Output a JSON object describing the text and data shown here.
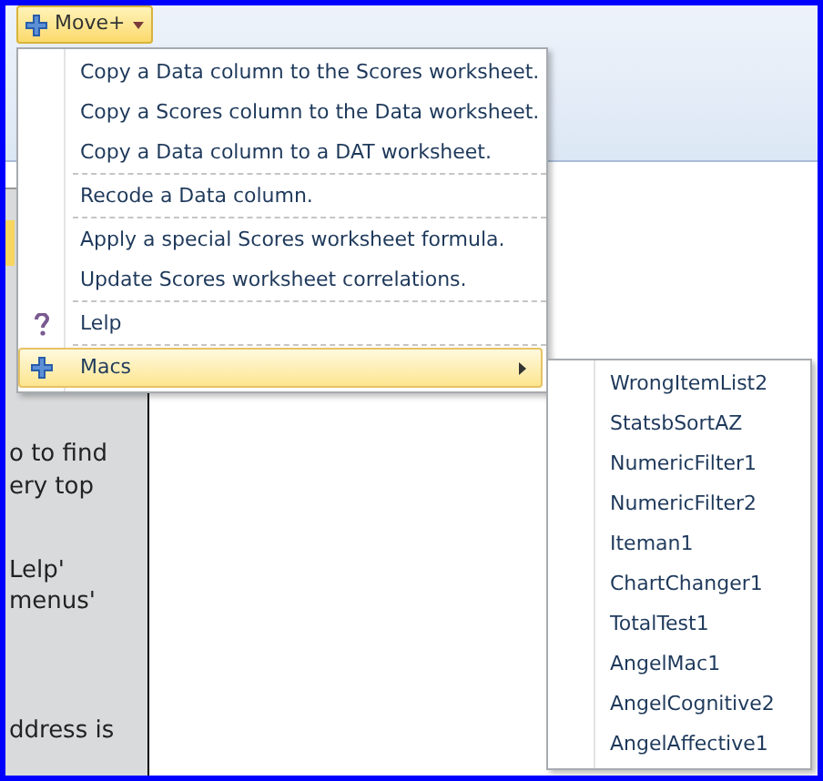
{
  "toolbar": {
    "button": {
      "label": "Move+"
    }
  },
  "sheet_text": [
    {
      "text": "o to find"
    },
    {
      "text": "ery top"
    },
    {
      "text": "Lelp'"
    },
    {
      "text": "menus'"
    },
    {
      "text": "ddress is"
    }
  ],
  "menu": {
    "groups": [
      [
        {
          "label": "Copy a Data column to the Scores worksheet.",
          "kind": "plain",
          "selected": false
        },
        {
          "label": "Copy a Scores column to the Data worksheet.",
          "kind": "plain",
          "selected": false
        },
        {
          "label": "Copy a Data column to a DAT worksheet.",
          "kind": "plain",
          "selected": false
        }
      ],
      [
        {
          "label": "Recode a Data column.",
          "kind": "plain",
          "selected": false
        }
      ],
      [
        {
          "label": "Apply a special Scores worksheet formula.",
          "kind": "plain",
          "selected": false
        },
        {
          "label": "Update Scores worksheet correlations.",
          "kind": "plain",
          "selected": false
        }
      ],
      [
        {
          "label": "Lelp",
          "kind": "help",
          "selected": false
        }
      ],
      [
        {
          "label": "Macs",
          "kind": "submenu",
          "selected": true
        }
      ]
    ]
  },
  "submenu": {
    "items": [
      {
        "label": "WrongItemList2"
      },
      {
        "label": "StatsbSortAZ"
      },
      {
        "label": "NumericFilter1"
      },
      {
        "label": "NumericFilter2"
      },
      {
        "label": "Iteman1"
      },
      {
        "label": "ChartChanger1"
      },
      {
        "label": "TotalTest1"
      },
      {
        "label": "AngelMac1"
      },
      {
        "label": "AngelCognitive2"
      },
      {
        "label": "AngelAffective1"
      }
    ]
  }
}
